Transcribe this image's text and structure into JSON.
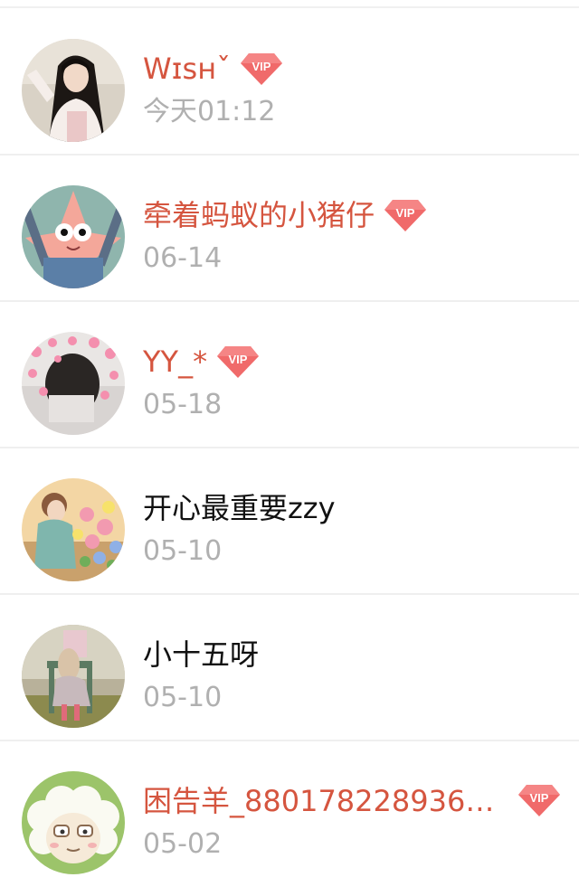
{
  "colors": {
    "vip_name": "#d5553f",
    "normal_name": "#111111",
    "time": "#b0b0b0",
    "divider": "#efefef",
    "vip_badge": "#f06a6a"
  },
  "vip_badge_label": "VIP",
  "contacts": [
    {
      "name": "Wɪsʜˇ",
      "time": "今天01:12",
      "vip": true,
      "avatar_icon": "girl-portrait-avatar"
    },
    {
      "name": "牵着蚂蚁的小猪仔",
      "time": "06-14",
      "vip": true,
      "avatar_icon": "patrick-star-avatar"
    },
    {
      "name": "YY_*",
      "time": "05-18",
      "vip": true,
      "avatar_icon": "hearts-photo-avatar"
    },
    {
      "name": "开心最重要zzy",
      "time": "05-10",
      "vip": false,
      "avatar_icon": "anime-boy-flowers-avatar"
    },
    {
      "name": "小十五呀",
      "time": "05-10",
      "vip": false,
      "avatar_icon": "girl-on-chair-avatar"
    },
    {
      "name": "困告羊_880178228936…",
      "time": "05-02",
      "vip": true,
      "avatar_icon": "lazy-sheep-avatar"
    }
  ]
}
